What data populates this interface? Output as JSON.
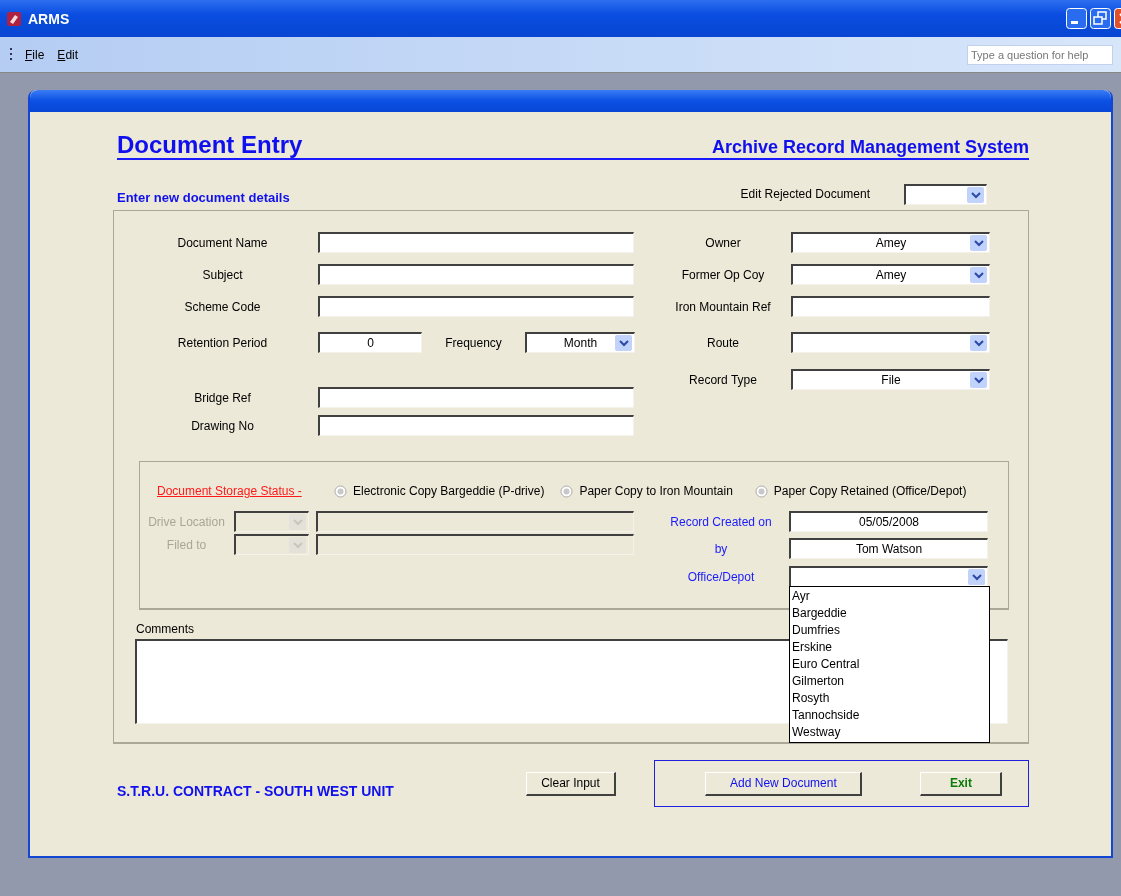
{
  "window": {
    "title": "ARMS"
  },
  "menu": [
    {
      "label": "File"
    },
    {
      "label": "Edit"
    }
  ],
  "help_box": {
    "placeholder": "Type a question for help"
  },
  "form": {
    "title": "Document Entry",
    "system_name": "Archive Record Management System",
    "section_heading": "Enter new document details",
    "edit_rejected": {
      "label": "Edit Rejected Document"
    },
    "left_fields": [
      {
        "kind": "text",
        "label": "Document Name"
      },
      {
        "kind": "text",
        "label": "Subject"
      },
      {
        "kind": "text",
        "label": "Scheme Code"
      },
      {
        "kind": "pair",
        "label": "Retention Period",
        "value": "0",
        "second_label": "Frequency",
        "second_value": "Month"
      },
      {
        "kind": "text",
        "label": "Bridge Ref"
      },
      {
        "kind": "text",
        "label": "Drawing No"
      }
    ],
    "right_fields": [
      {
        "kind": "combo",
        "label": "Owner",
        "value": "Amey"
      },
      {
        "kind": "combo",
        "label": "Former Op Coy",
        "value": "Amey"
      },
      {
        "kind": "text",
        "label": "Iron Mountain Ref"
      },
      {
        "kind": "combo",
        "label": "Route"
      },
      {
        "kind": "combo",
        "label": "Record Type",
        "value": "File"
      }
    ],
    "storage": {
      "label": "Document Storage Status -",
      "options": [
        {
          "label": "Electronic Copy Bargeddie (P-drive)",
          "selected": false
        },
        {
          "label": "Paper Copy to Iron Mountain",
          "selected": false
        },
        {
          "label": "Paper Copy Retained (Office/Depot)",
          "selected": false
        }
      ],
      "location_fields": [
        {
          "label": "Drive Location",
          "disabled": true
        },
        {
          "label": "Filed to",
          "disabled": true
        }
      ],
      "record_fields": [
        {
          "kind": "text",
          "label": "Record Created on",
          "value": "05/05/2008"
        },
        {
          "kind": "text",
          "label": "by",
          "value": "Tom Watson"
        },
        {
          "kind": "combo",
          "label": "Office/Depot",
          "expanded": true,
          "options": [
            "Ayr",
            "Bargeddie",
            "Dumfries",
            "Erskine",
            "Euro Central",
            "Gilmerton",
            "Rosyth",
            "Tannochside",
            "Westway"
          ]
        }
      ]
    },
    "comments": {
      "label": "Comments"
    }
  },
  "footer": {
    "unit": "S.T.R.U. CONTRACT - SOUTH WEST UNIT",
    "clear_button": {
      "label": "Clear Input"
    },
    "action_buttons": [
      {
        "label": "Add New Document",
        "kind": "primary"
      },
      {
        "label": "Exit",
        "kind": "exit"
      }
    ]
  }
}
